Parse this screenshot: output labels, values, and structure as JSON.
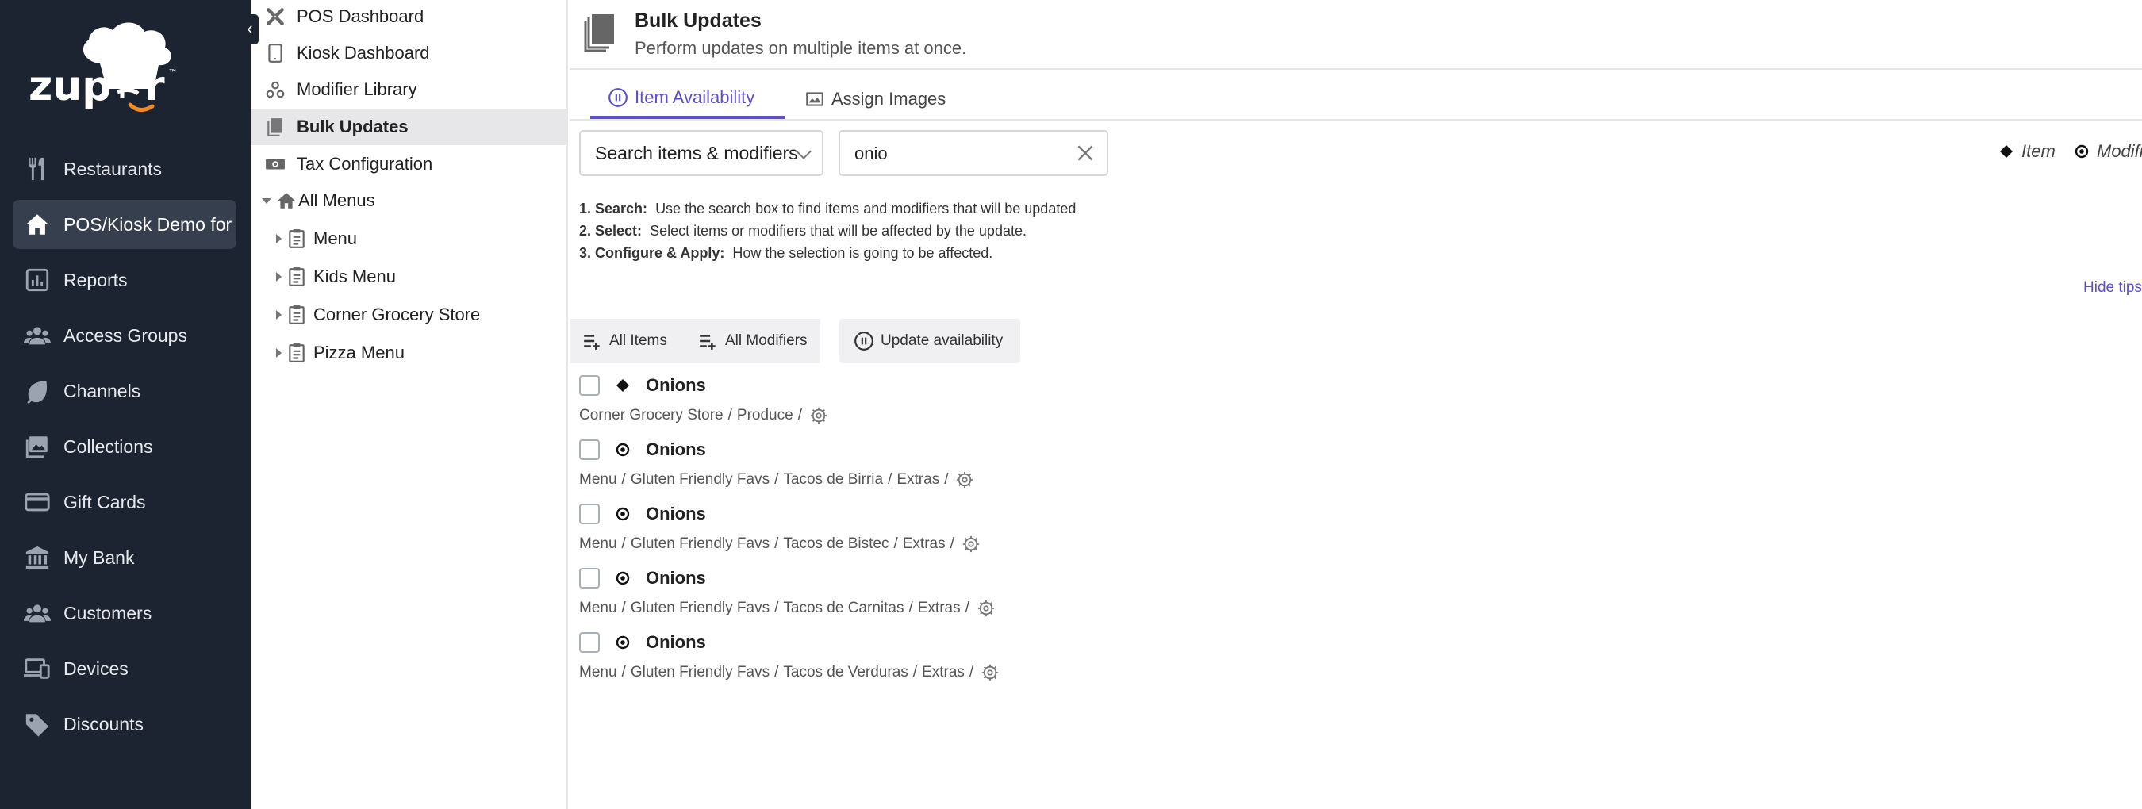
{
  "nav": {
    "items": [
      {
        "label": "Restaurants",
        "icon": "fork-knife-icon"
      },
      {
        "label": "POS/Kiosk Demo for R",
        "icon": "home-icon",
        "active": true
      },
      {
        "label": "Reports",
        "icon": "chart-icon"
      },
      {
        "label": "Access Groups",
        "icon": "users-icon"
      },
      {
        "label": "Channels",
        "icon": "leaf-icon"
      },
      {
        "label": "Collections",
        "icon": "images-icon"
      },
      {
        "label": "Gift Cards",
        "icon": "card-icon"
      },
      {
        "label": "My Bank",
        "icon": "bank-icon"
      },
      {
        "label": "Customers",
        "icon": "users-icon"
      },
      {
        "label": "Devices",
        "icon": "devices-icon"
      },
      {
        "label": "Discounts",
        "icon": "tag-icon"
      }
    ]
  },
  "tree": {
    "items": [
      {
        "label": "POS Dashboard"
      },
      {
        "label": "Kiosk Dashboard"
      },
      {
        "label": "Modifier Library"
      },
      {
        "label": "Bulk Updates"
      },
      {
        "label": "Tax Configuration"
      },
      {
        "label": "All Menus"
      },
      {
        "label": "Menu"
      },
      {
        "label": "Kids Menu"
      },
      {
        "label": "Corner Grocery Store"
      },
      {
        "label": "Pizza Menu"
      }
    ]
  },
  "header": {
    "title": "Bulk Updates",
    "subtitle": "Perform updates on multiple items at once."
  },
  "tabs": [
    {
      "label": "Item Availability",
      "active": true
    },
    {
      "label": "Assign Images"
    }
  ],
  "search": {
    "mode": "Search items & modifiers",
    "value": "onio"
  },
  "legend": {
    "item": "Item",
    "modifier": "Modifi"
  },
  "tips": [
    {
      "step": "1. Search:",
      "text": "Use the search box to find items and modifiers that will be updated"
    },
    {
      "step": "2. Select:",
      "text": "Select items or modifiers that will be affected by the update."
    },
    {
      "step": "3. Configure & Apply:",
      "text": "How the selection is going to be affected."
    }
  ],
  "hide_tips": "Hide tips",
  "actions": {
    "all_items": "All Items",
    "all_modifiers": "All Modifiers",
    "update": "Update availability"
  },
  "results": [
    {
      "name": "Onions",
      "type": "item",
      "path": [
        "Corner Grocery Store",
        "/",
        "Produce",
        "/"
      ]
    },
    {
      "name": "Onions",
      "type": "modifier",
      "path": [
        "Menu",
        "/",
        "Gluten Friendly Favs",
        "/",
        "Tacos de Birria",
        "/",
        "Extras",
        "/"
      ]
    },
    {
      "name": "Onions",
      "type": "modifier",
      "path": [
        "Menu",
        "/",
        "Gluten Friendly Favs",
        "/",
        "Tacos de Bistec",
        "/",
        "Extras",
        "/"
      ]
    },
    {
      "name": "Onions",
      "type": "modifier",
      "path": [
        "Menu",
        "/",
        "Gluten Friendly Favs",
        "/",
        "Tacos de Carnitas",
        "/",
        "Extras",
        "/"
      ]
    },
    {
      "name": "Onions",
      "type": "modifier",
      "path": [
        "Menu",
        "/",
        "Gluten Friendly Favs",
        "/",
        "Tacos de Verduras",
        "/",
        "Extras",
        "/"
      ]
    }
  ],
  "colors": {
    "nav_bg": "#1c2431",
    "accent": "#5b50c8"
  }
}
